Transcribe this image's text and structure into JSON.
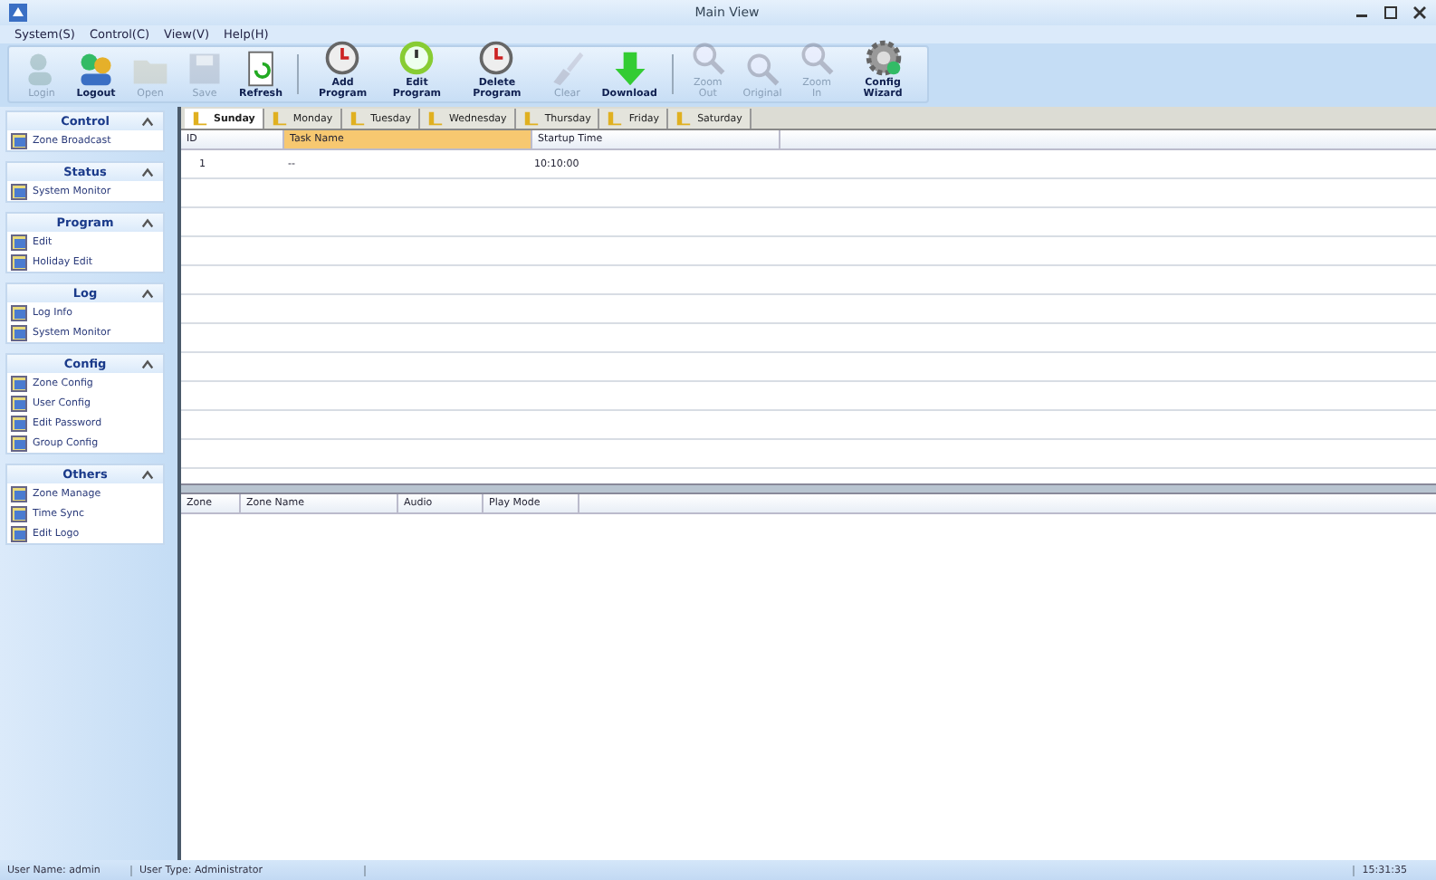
{
  "window": {
    "title": "Main View"
  },
  "menu": [
    "System(S)",
    "Control(C)",
    "View(V)",
    "Help(H)"
  ],
  "toolbar": [
    {
      "label": "Login",
      "kind": "user",
      "disabled": true
    },
    {
      "label": "Logout",
      "kind": "users",
      "disabled": false
    },
    {
      "label": "Open",
      "kind": "folder",
      "disabled": true
    },
    {
      "label": "Save",
      "kind": "disk",
      "disabled": true
    },
    {
      "label": "Refresh",
      "kind": "refresh",
      "disabled": false
    },
    {
      "label": "Add Program",
      "kind": "clock",
      "disabled": false
    },
    {
      "label": "Edit Program",
      "kind": "timer",
      "disabled": false
    },
    {
      "label": "Delete Program",
      "kind": "clock",
      "disabled": false
    },
    {
      "label": "Clear",
      "kind": "brush",
      "disabled": true
    },
    {
      "label": "Download",
      "kind": "download",
      "disabled": false
    },
    {
      "label": "Zoom Out",
      "kind": "zoom",
      "disabled": true
    },
    {
      "label": "Original",
      "kind": "zoom",
      "disabled": true
    },
    {
      "label": "Zoom In",
      "kind": "zoom",
      "disabled": true
    },
    {
      "label": "Config Wizard",
      "kind": "gear",
      "disabled": false
    }
  ],
  "sidebar": [
    {
      "title": "Control",
      "items": [
        "Zone Broadcast"
      ]
    },
    {
      "title": "Status",
      "items": [
        "System Monitor"
      ]
    },
    {
      "title": "Program",
      "items": [
        "Edit",
        "Holiday Edit"
      ]
    },
    {
      "title": "Log",
      "items": [
        "Log Info",
        "System Monitor"
      ]
    },
    {
      "title": "Config",
      "items": [
        "Zone Config",
        "User Config",
        "Edit Password",
        "Group Config"
      ]
    },
    {
      "title": "Others",
      "items": [
        "Zone Manage",
        "Time Sync",
        "Edit Logo"
      ]
    }
  ],
  "tabs": [
    {
      "label": "Sunday",
      "selected": true
    },
    {
      "label": "Monday",
      "selected": false
    },
    {
      "label": "Tuesday",
      "selected": false
    },
    {
      "label": "Wednesday",
      "selected": false
    },
    {
      "label": "Thursday",
      "selected": false
    },
    {
      "label": "Friday",
      "selected": false
    },
    {
      "label": "Saturday",
      "selected": false
    }
  ],
  "task_table": {
    "columns": [
      "ID",
      "Task Name",
      "Startup Time"
    ],
    "rows": [
      [
        "1",
        "--",
        "10:10:00"
      ]
    ]
  },
  "zone_table": {
    "columns": [
      "Zone",
      "Zone Name",
      "Audio",
      "Play Mode"
    ]
  },
  "status_bar": [
    "User Name: admin",
    "User Type: Administrator",
    "15:31:35"
  ]
}
